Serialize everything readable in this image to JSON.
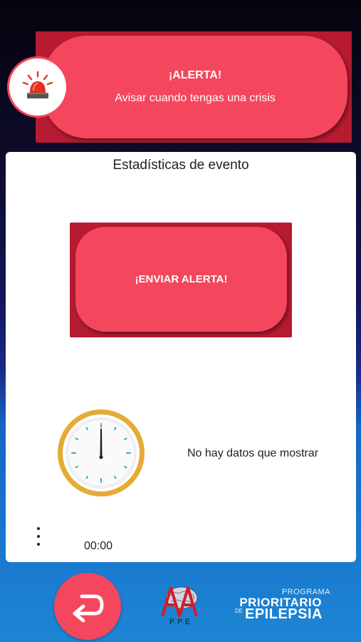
{
  "alert_banner": {
    "title": "¡ALERTA!",
    "subtitle": "Avisar cuando tengas una crisis",
    "icon": "siren-icon"
  },
  "card": {
    "title": "Estadísticas de evento",
    "send_button_label": "¡ENVIAR ALERTA!",
    "empty_message": "No hay datos que mostrar",
    "timer": "00:00",
    "clock_icon": "clock-icon",
    "menu_icon": "more-vert-icon"
  },
  "bottom_bar": {
    "back_icon": "return-arrow-icon",
    "ppe_label": "P.P.E",
    "program_line1": "PROGRAMA",
    "program_line2": "PRIORITARIO",
    "program_line3": "DE",
    "program_line4": "EPILEPSIA"
  },
  "colors": {
    "accent": "#f4465c",
    "accent_dark": "#b71b32",
    "clock_ring": "#e5ab35",
    "bottom_blue": "#1d86d4"
  }
}
